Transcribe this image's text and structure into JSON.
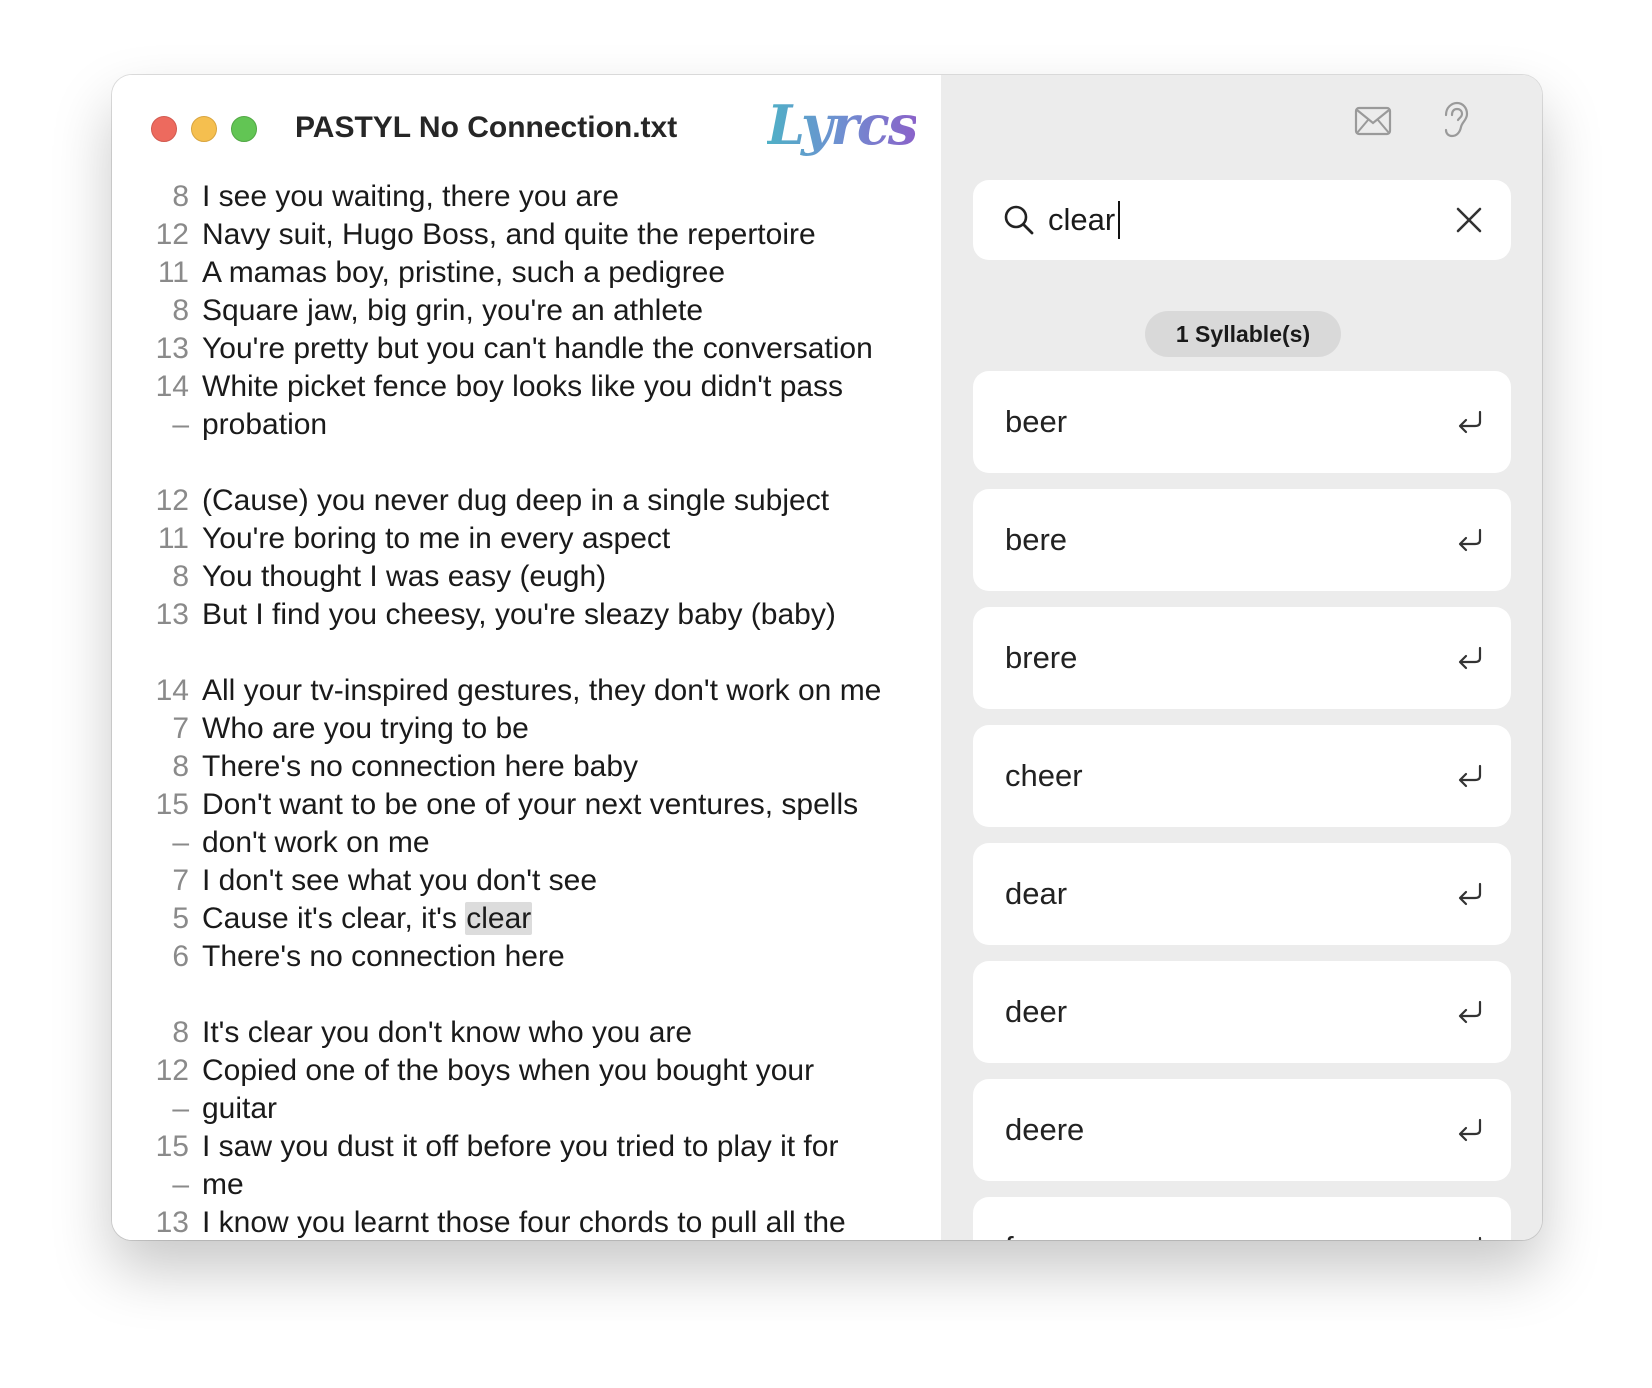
{
  "window": {
    "document_title": "PASTYL No Connection.txt",
    "logo_text": "Lyrcs"
  },
  "toolbar": {
    "icons": [
      "envelope-icon",
      "ear-icon"
    ]
  },
  "editor": {
    "lines": [
      {
        "num": "8",
        "text": "I see you waiting, there you are"
      },
      {
        "num": "12",
        "text": "Navy suit, Hugo Boss, and quite the repertoire"
      },
      {
        "num": "11",
        "text": "A mamas boy, pristine, such a pedigree"
      },
      {
        "num": "8",
        "text": "Square jaw, big grin, you're an athlete"
      },
      {
        "num": "13",
        "text": "You're pretty but you can't handle the conversation"
      },
      {
        "num": "14",
        "text": "White picket fence boy looks like you didn't pass"
      },
      {
        "num": "–",
        "text": "probation"
      },
      {
        "num": "",
        "text": ""
      },
      {
        "num": "12",
        "text": "(Cause) you never dug deep in a single subject"
      },
      {
        "num": "11",
        "text": "You're boring to me in every aspect"
      },
      {
        "num": "8",
        "text": "You thought I was easy (eugh)"
      },
      {
        "num": "13",
        "text": "But I find you cheesy, you're sleazy baby (baby)"
      },
      {
        "num": "",
        "text": ""
      },
      {
        "num": "14",
        "text": "All your tv-inspired gestures, they don't work on me"
      },
      {
        "num": "7",
        "text": "Who are you trying to be"
      },
      {
        "num": "8",
        "text": "There's no connection here baby"
      },
      {
        "num": "15",
        "text": "Don't want to be one of your next ventures, spells"
      },
      {
        "num": "–",
        "text": "don't work on me"
      },
      {
        "num": "7",
        "text": "I don't see what you don't see"
      },
      {
        "num": "5",
        "text": "Cause it's clear, it's ",
        "highlight": "clear"
      },
      {
        "num": "6",
        "text": "There's no connection here"
      },
      {
        "num": "",
        "text": ""
      },
      {
        "num": "8",
        "text": "It's clear you don't know who you are"
      },
      {
        "num": "12",
        "text": "Copied one of the boys when you bought your"
      },
      {
        "num": "–",
        "text": "guitar"
      },
      {
        "num": "15",
        "text": "I saw you dust it off before you tried to play it for"
      },
      {
        "num": "–",
        "text": "me"
      },
      {
        "num": "13",
        "text": "I know you learnt those four chords to pull all the"
      }
    ]
  },
  "search": {
    "value": "clear",
    "clear_icon": "close-icon"
  },
  "syllable_filter": "1 Syllable(s)",
  "results": [
    {
      "word": "beer"
    },
    {
      "word": "bere"
    },
    {
      "word": "brere"
    },
    {
      "word": "cheer"
    },
    {
      "word": "dear"
    },
    {
      "word": "deer"
    },
    {
      "word": "deere"
    },
    {
      "word": "f"
    }
  ],
  "colors": {
    "sidebar_bg": "#ececec",
    "card_bg": "#ffffff",
    "highlight": "#dcdcdc",
    "traffic_red": "#ed6a5e",
    "traffic_yellow": "#f5bf4f",
    "traffic_green": "#62c554"
  }
}
